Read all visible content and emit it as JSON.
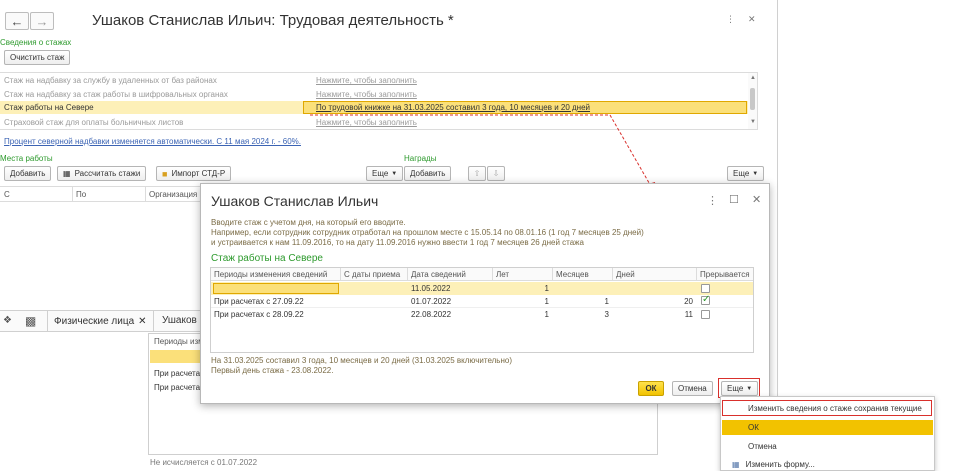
{
  "main": {
    "title": "Ушаков Станислав Ильич: Трудовая деятельность *",
    "section_label": "Сведения о стажах",
    "clear_button": "Очистить стаж",
    "stazh_rows": [
      {
        "label": "Стаж на надбавку за службу в удаленных от баз районах",
        "value": "Нажмите, чтобы заполнить"
      },
      {
        "label": "Стаж на надбавку за стаж работы в шифровальных органах",
        "value": "Нажмите, чтобы заполнить"
      },
      {
        "label": "Стаж работы на Севере",
        "value": "По трудовой книжке на 31.03.2025 составил 3 года, 10 месяцев и 20 дней"
      },
      {
        "label": "Страховой стаж для оплаты больничных листов",
        "value": "Нажмите, чтобы заполнить"
      }
    ],
    "north_percent_link": "Процент северной надбавки изменяется автоматически. С 11 мая 2024 г. - 60%.",
    "places_label": "Места работы",
    "add_button": "Добавить",
    "calc_button": "Рассчитать стажи",
    "import_button": "Импорт СТД-Р",
    "more_button": "Еще",
    "awards_label": "Награды",
    "awards_add_button": "Добавить",
    "awards_more_button": "Еще",
    "columns": [
      "С",
      "По",
      "Организация"
    ]
  },
  "taskbar": {
    "tab1": "Физические лица",
    "tab2": "Ушаков"
  },
  "background_form": {
    "header": "Периоды изм",
    "row1": "При расчетах",
    "row2": "При расчетах",
    "footer": "Не исчисляется с 01.07.2022"
  },
  "dialog": {
    "title": "Ушаков Станислав Ильич",
    "hint1": "Вводите стаж с учетом дня, на который его вводите.",
    "hint2": "Например, если сотрудник сотрудник отработал на прошлом месте с 15.05.14 по 08.01.16 (1 год 7 месяцев 25 дней)",
    "hint3": "и устраивается к нам 11.09.2016, то на дату 11.09.2016 нужно ввести 1 год 7 месяцев 26 дней стажа",
    "section_title": "Стаж работы на Севере",
    "columns": [
      "Периоды изменения сведений",
      "С даты приема",
      "Дата сведений",
      "Лет",
      "Месяцев",
      "Дней",
      "Прерывается"
    ],
    "rows": [
      {
        "period": "",
        "from_hire": "",
        "date": "11.05.2022",
        "years": "1",
        "months": "",
        "days": "",
        "interrupted": false
      },
      {
        "period": "При расчетах с  27.09.22",
        "from_hire": "",
        "date": "01.07.2022",
        "years": "1",
        "months": "1",
        "days": "20",
        "interrupted": true
      },
      {
        "period": "При расчетах с  28.09.22",
        "from_hire": "",
        "date": "22.08.2022",
        "years": "1",
        "months": "3",
        "days": "11",
        "interrupted": false
      }
    ],
    "summary1": "На 31.03.2025 составил 3 года, 10 месяцев и 20 дней (31.03.2025 включительно)",
    "summary2": "Первый день стажа - 23.08.2022.",
    "ok_button": "ОК",
    "cancel_button": "Отмена",
    "more_button": "Еще"
  },
  "menu": {
    "items": [
      "Изменить сведения о стаже сохранив текущие",
      "ОК",
      "Отмена",
      "Изменить форму..."
    ]
  },
  "colors": {
    "highlight": "#fbe07a",
    "accent_red": "#d9302c",
    "green": "#2d9a2d",
    "link": "#3c64b4"
  }
}
